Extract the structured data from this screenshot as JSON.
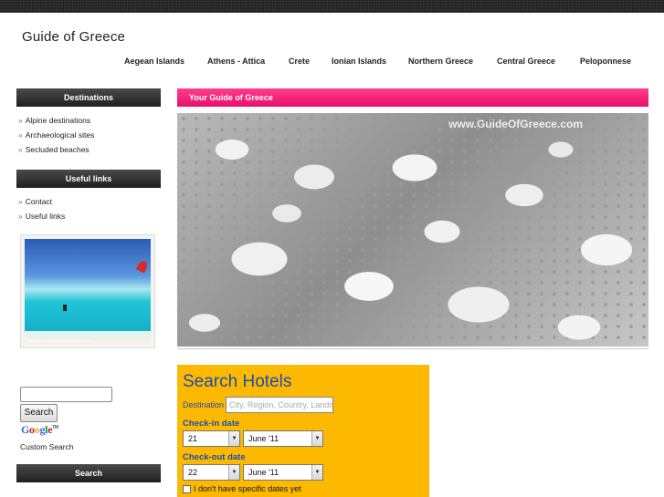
{
  "header": {
    "site_title": "Guide of Greece"
  },
  "nav": {
    "items": [
      {
        "label": "Aegean Islands"
      },
      {
        "label": "Athens - Attica"
      },
      {
        "label": "Crete"
      },
      {
        "label": "Ionian Islands"
      },
      {
        "label": "Northern Greece"
      },
      {
        "label": "Central Greece"
      },
      {
        "label": "Peloponnese"
      }
    ]
  },
  "sidebar": {
    "destinations_title": "Destinations",
    "destinations": [
      {
        "label": "Alpine destinations"
      },
      {
        "label": "Archaeological sites"
      },
      {
        "label": "Secluded beaches"
      }
    ],
    "useful_links_title": "Useful links",
    "useful_links": [
      {
        "label": "Contact"
      },
      {
        "label": "Useful links"
      }
    ],
    "photo_credit": "MADE WITH MYBANNERMAKER.COM",
    "search_button": "Search",
    "google_logo": {
      "g1": "G",
      "g2": "o",
      "g3": "o",
      "g4": "g",
      "g5": "l",
      "g6": "e",
      "tm": "TM"
    },
    "custom_search": "Custom Search",
    "search_title": "Search"
  },
  "main": {
    "header_title": "Your Guide of Greece",
    "hero_watermark": "www.GuideOfGreece.com"
  },
  "hotels": {
    "title": "Search Hotels",
    "destination_label": "Destination",
    "destination_placeholder": "City, Region, Country, Landmark",
    "checkin_label": "Check-in date",
    "checkin_day": "21",
    "checkin_month": "June '11",
    "checkout_label": "Check-out date",
    "checkout_day": "22",
    "checkout_month": "June '11",
    "no_dates_label": "I don't have specific dates yet"
  },
  "colors": {
    "accent_pink": "#e8106a",
    "hotels_bg": "#fcb900",
    "hotels_text": "#1c4cb0"
  }
}
